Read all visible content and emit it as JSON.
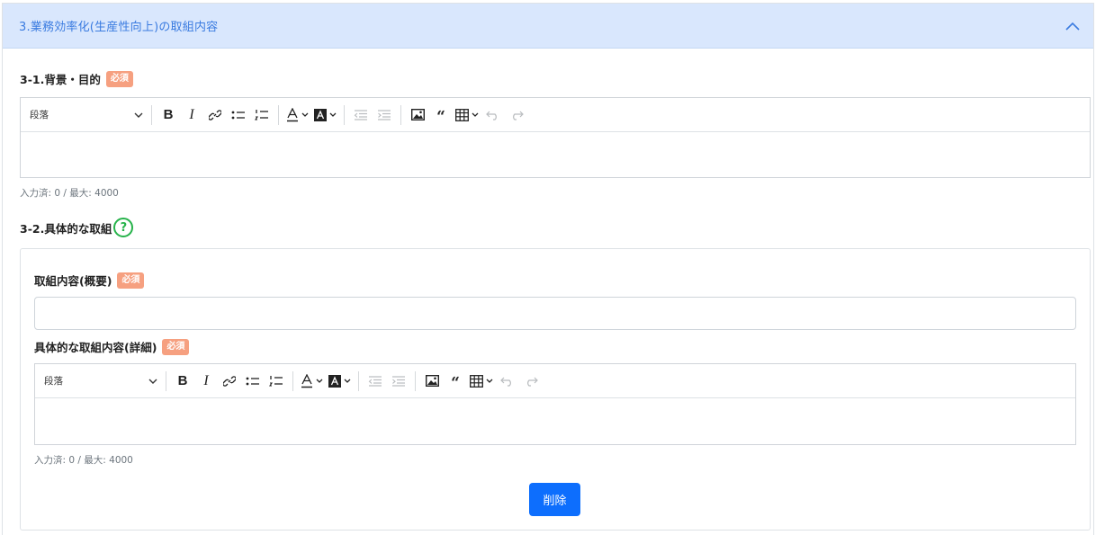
{
  "panel": {
    "title": "3.業務効率化(生産性向上)の取組内容"
  },
  "section1": {
    "label": "3-1.背景・目的",
    "badge": "必須",
    "editor": {
      "paragraph_select": "段落",
      "content": ""
    },
    "counter": "入力済: 0 / 最大: 4000"
  },
  "section2": {
    "label": "3-2.具体的な取組",
    "help_symbol": "?",
    "summary": {
      "label": "取組内容(概要)",
      "badge": "必須",
      "value": ""
    },
    "detail": {
      "label": "具体的な取組内容(詳細)",
      "badge": "必須",
      "editor": {
        "paragraph_select": "段落",
        "content": ""
      },
      "counter": "入力済: 0 / 最大: 4000"
    },
    "delete_label": "削除"
  },
  "colors": {
    "header_bg": "#d9e7fd",
    "header_text": "#3a7be0",
    "required_badge": "#f6a080",
    "help_icon": "#27b34b",
    "primary_button": "#0d6efd"
  },
  "toolbar_icons": [
    "bold-icon",
    "italic-icon",
    "link-icon",
    "bulleted-list-icon",
    "numbered-list-icon",
    "font-color-icon",
    "background-color-icon",
    "outdent-icon",
    "indent-icon",
    "image-icon",
    "blockquote-icon",
    "table-icon",
    "undo-icon",
    "redo-icon"
  ]
}
